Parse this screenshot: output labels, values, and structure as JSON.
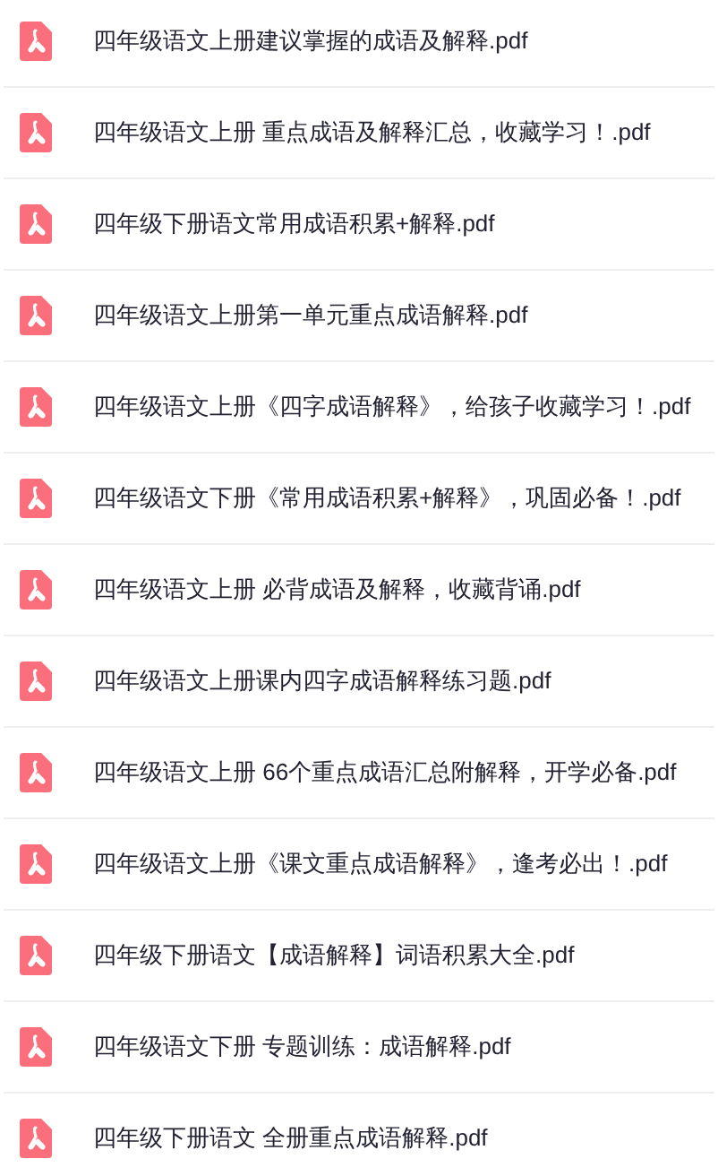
{
  "files": [
    {
      "name": "四年级语文上册建议掌握的成语及解释.pdf"
    },
    {
      "name": "四年级语文上册 重点成语及解释汇总，收藏学习！.pdf"
    },
    {
      "name": "四年级下册语文常用成语积累+解释.pdf"
    },
    {
      "name": "四年级语文上册第一单元重点成语解释.pdf"
    },
    {
      "name": "四年级语文上册《四字成语解释》，给孩子收藏学习！.pdf"
    },
    {
      "name": "四年级语文下册《常用成语积累+解释》，巩固必备！.pdf"
    },
    {
      "name": "四年级语文上册 必背成语及解释，收藏背诵.pdf"
    },
    {
      "name": "四年级语文上册课内四字成语解释练习题.pdf"
    },
    {
      "name": "四年级语文上册 66个重点成语汇总附解释，开学必备.pdf"
    },
    {
      "name": "四年级语文上册《课文重点成语解释》，逢考必出！.pdf"
    },
    {
      "name": "四年级下册语文【成语解释】词语积累大全.pdf"
    },
    {
      "name": "四年级语文下册 专题训练：成语解释.pdf"
    },
    {
      "name": "四年级下册语文 全册重点成语解释.pdf"
    }
  ]
}
